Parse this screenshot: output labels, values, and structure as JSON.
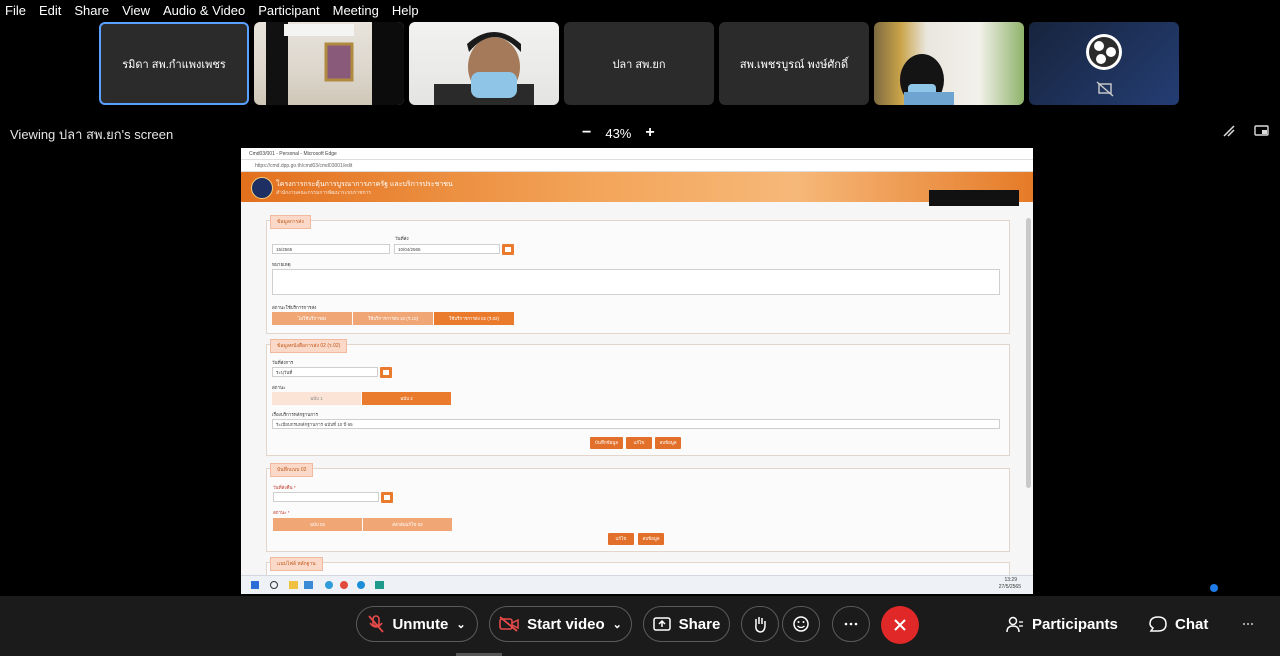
{
  "menu": [
    "File",
    "Edit",
    "Share",
    "View",
    "Audio & Video",
    "Participant",
    "Meeting",
    "Help"
  ],
  "participants": [
    {
      "name": "รมิดา สพ.กำแพงเพชร",
      "video": false,
      "active": true
    },
    {
      "name": "",
      "video": true,
      "active": false
    },
    {
      "name": "",
      "video": true,
      "active": false
    },
    {
      "name": "ปลา สพ.ยก",
      "video": false,
      "active": false
    },
    {
      "name": "สพ.เพชรบูรณ์ พงษ์ศักดิ์",
      "video": false,
      "active": false
    },
    {
      "name": "",
      "video": true,
      "active": false
    },
    {
      "name": "",
      "video": true,
      "active": false
    }
  ],
  "viewing_label": "Viewing ปลา สพ.ยก's screen",
  "zoom": {
    "minus": "−",
    "level": "43%",
    "plus": "+"
  },
  "shared": {
    "browser_title": "Cmd03/001 - Personal - Microsoft Edge",
    "url": "https://cmd.dpp.go.th/cmd03/cmd03001/edit",
    "site_title": "โครงการกระตุ้นการบูรณาการภาครัฐ และบริการประชาชน",
    "site_subtitle": "สำนักงานคณะกรรมการพัฒนาระบบราชการ",
    "section1": {
      "tab": "ข้อมูลการส่ง",
      "date_label": "วันที่ส่ง",
      "date_value": "10/04/2565",
      "field_value": "15/2565",
      "note_label": "หมายเหตุ",
      "status_label": "สถานะใช้บริการการส่ง",
      "segments": [
        "ไม่ใช้บริการส่ง",
        "ใช้บริการการส่ง 10 (ร.10)",
        "ใช้บริการการส่ง 02 (ร.02)"
      ]
    },
    "section2": {
      "tab": "ข้อมูลหนังสือการส่ง 02 (ร.02)",
      "date_label": "วันที่ส่งการ",
      "date_value": "ระบุวันที่",
      "status_label": "สถานะ",
      "options": [
        "ฉบับ 1",
        "ฉบับ 2"
      ],
      "detail_label": "เรื่องบริการหลักฐานการ",
      "detail_value": "ระเบียบกรมหลักฐานการ ฉบับที่ 10 ปี 65",
      "buttons": [
        "บันทึกข้อมูล",
        "แก้ไข",
        "ลบข้อมูล"
      ]
    },
    "section3": {
      "tab": "บันทึกแบบ 02",
      "date_label": "วันที่ส่งคืน *",
      "status_label": "สถานะ *",
      "options": [
        "ฉบับ 02",
        "ส่งกลับแก้ไข 02"
      ],
      "buttons": [
        "แก้ไข",
        "ลบข้อมูล"
      ]
    },
    "section4": {
      "tab": "แนบไฟล์ หลักฐาน"
    },
    "taskbar_time": "13:29",
    "taskbar_date": "27/5/2565"
  },
  "toolbar": {
    "unmute": "Unmute",
    "start_video": "Start video",
    "share": "Share",
    "participants": "Participants",
    "chat": "Chat"
  },
  "colors": {
    "accent": "#e2702a",
    "leave": "#e02828",
    "active_border": "#5aa0ff"
  }
}
